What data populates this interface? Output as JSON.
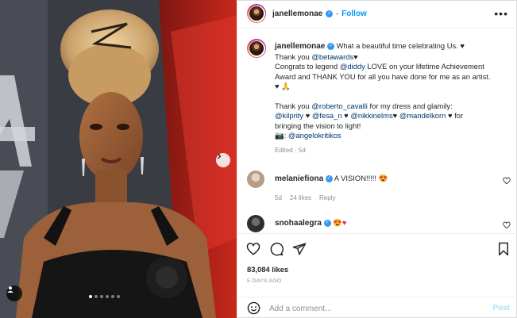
{
  "post": {
    "author": "janellemonae",
    "follow_label": "Follow",
    "more_label": "•••",
    "dot_separator": "•",
    "image_alt": "Portrait photo",
    "carousel": {
      "total": 6,
      "active": 1
    }
  },
  "caption": {
    "username": "janellemonae",
    "line1": "What a beautiful time celebrating Us.",
    "line2_pre": "Thank you ",
    "mention_betawards": "@betawards",
    "line3_pre": "Congrats to legend ",
    "mention_diddy": "@diddy",
    "line3_post": " LOVE on your lifetime Achievement",
    "line4": "Award and THANK YOU for all you have done for me as an artist.",
    "line5_pre": "Thank you ",
    "mention_cavalli": "@roberto_cavalli",
    "line5_post": " for my dress and glamily:",
    "mention_kilprity": "@kilprity",
    "mention_fesa": "@fesa_n",
    "mention_nikki": "@nikkinelms",
    "mention_mandel": "@mandelkorn",
    "line6_post": " for",
    "line7": "bringing the vision to light!",
    "photo_credit_prefix": ": ",
    "mention_angelo": "@angelokritikos",
    "edited": "Edited · 5d"
  },
  "comments": [
    {
      "username": "melaniefiona",
      "text": "A VISION!!!!!",
      "age": "5d",
      "likes": "24 likes",
      "reply": "Reply"
    },
    {
      "username": "snohaalegra",
      "text": ""
    }
  ],
  "actions": {
    "likes": "83,084 likes",
    "time_ago": "5 DAYS AGO"
  },
  "add_comment": {
    "placeholder": "Add a comment...",
    "post_label": "Post"
  },
  "colors": {
    "accent": "#0095f6",
    "link": "#00376b",
    "muted": "#8e8e8e"
  },
  "icons": [
    "chevron-right-icon",
    "user-tag-icon",
    "verified-icon",
    "more-icon",
    "heart-icon",
    "comment-icon",
    "share-icon",
    "bookmark-icon",
    "emoji-icon",
    "black-heart-icon"
  ]
}
